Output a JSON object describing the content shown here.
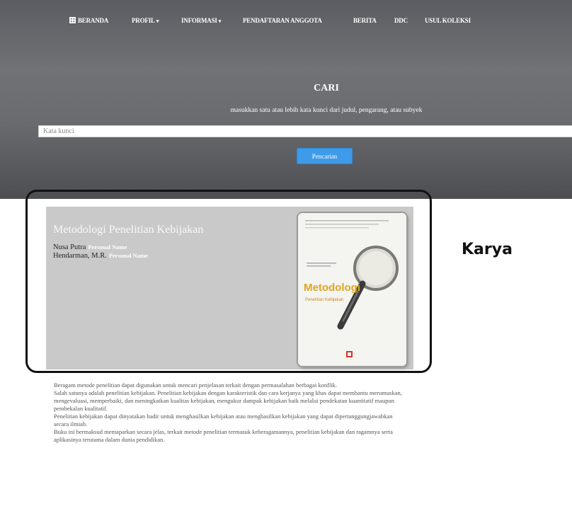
{
  "nav": {
    "items": [
      {
        "label": "BERANDA",
        "has_dropdown": false,
        "icon": "home-icon"
      },
      {
        "label": "PROFIL",
        "has_dropdown": true
      },
      {
        "label": "INFORMASI",
        "has_dropdown": true
      },
      {
        "label": "PENDAFTARAN ANGGOTA",
        "has_dropdown": false
      },
      {
        "label": "BERITA",
        "has_dropdown": false
      },
      {
        "label": "DDC",
        "has_dropdown": false
      },
      {
        "label": "USUL KOLEKSI",
        "has_dropdown": false
      }
    ]
  },
  "search": {
    "title": "CARI",
    "subtitle": "masukkan satu atau lebih kata kunci dari judul, pengarang, atau subyek",
    "placeholder": "Kata kunci",
    "value": "",
    "button_label": "Pencarian"
  },
  "book": {
    "title": "Metodologi Penelitian Kebijakan",
    "authors": [
      {
        "name": "Nusa Putra",
        "role": "Personal Name"
      },
      {
        "name": "Hendarman, M.R.",
        "role": "Personal Name"
      }
    ],
    "cover": {
      "title": "Metodologi",
      "subtitle": "Penelitian Kebijakan"
    }
  },
  "annotation": {
    "label": "Karya"
  },
  "description": {
    "paragraphs": [
      "Beragam metode penelitian dapat digunakan untuk mencari penjelasan terkait dengan permasalahan berbagai konflik.",
      "Salah satunya adalah penelitian kebijakan. Penelitian kebijakan dengan karakteristik dan cara kerjanya yang khas dapat membantu merumuskan, mengevaluasi, memperbaiki, dan meningkatkan kualitas kebijakan, mengukur dampak kebijakan baik melalui pendekatan kuantitatif maupun pembekalan kualitatif.",
      "Penelitian kebijakan dapat dinyatakan hadir untuk menghasilkan kebijakan atau menghasilkan kebijakan yang dapat dipertanggungjawabkan secara ilmiah.",
      "Buku ini bermaksud memaparkan secara jelas, terkait metode penelitian termasuk keberagamannya, penelitian kebijakan dan ragamnya serta aplikasinya terutama dalam dunia pendidikan."
    ]
  },
  "colors": {
    "hero_top": "#5c5d62",
    "hero_bottom": "#4d4e51",
    "search_button": "#3d9be9",
    "card_background": "#c9c9c9",
    "cover_title": "#e0a51e"
  }
}
